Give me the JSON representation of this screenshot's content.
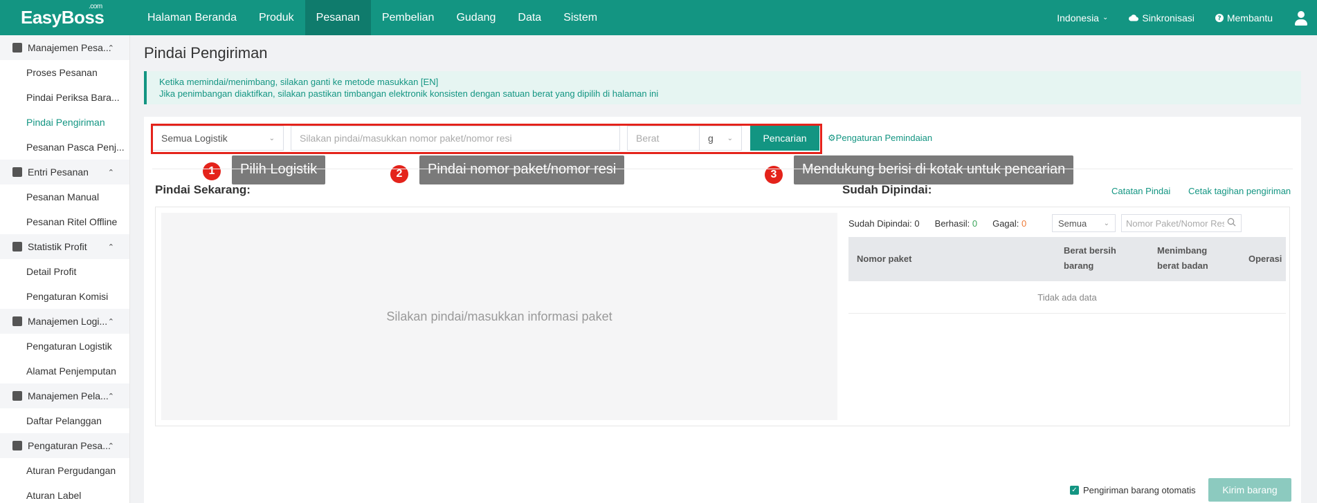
{
  "app": {
    "logo": "EasyBoss",
    "logo_sup": ".com"
  },
  "nav": {
    "items": [
      {
        "label": "Halaman Beranda"
      },
      {
        "label": "Produk"
      },
      {
        "label": "Pesanan"
      },
      {
        "label": "Pembelian"
      },
      {
        "label": "Gudang"
      },
      {
        "label": "Data"
      },
      {
        "label": "Sistem"
      }
    ],
    "active": "Pesanan",
    "language": "Indonesia",
    "sync": "Sinkronisasi",
    "help": "Membantu"
  },
  "sidebar": {
    "groups": [
      {
        "label": "Manajemen Pesa...",
        "items": [
          "Proses Pesanan",
          "Pindai Periksa Bara...",
          "Pindai Pengiriman",
          "Pesanan Pasca Penj..."
        ]
      },
      {
        "label": "Entri Pesanan",
        "items": [
          "Pesanan Manual",
          "Pesanan Ritel Offline"
        ]
      },
      {
        "label": "Statistik Profit",
        "items": [
          "Detail Profit",
          "Pengaturan Komisi"
        ]
      },
      {
        "label": "Manajemen Logi...",
        "items": [
          "Pengaturan Logistik",
          "Alamat Penjemputan"
        ]
      },
      {
        "label": "Manajemen Pela...",
        "items": [
          "Daftar Pelanggan"
        ]
      },
      {
        "label": "Pengaturan Pesa...",
        "items": [
          "Aturan Pergudangan",
          "Aturan Label"
        ]
      }
    ],
    "active_item": "Pindai Pengiriman"
  },
  "page": {
    "title": "Pindai Pengiriman",
    "notice_line1": "Ketika memindai/menimbang, silakan ganti ke metode masukkan [EN]",
    "notice_line2": "Jika penimbangan diaktifkan, silakan pastikan timbangan elektronik konsisten dengan satuan berat yang dipilih di halaman ini"
  },
  "search": {
    "logistics_value": "Semua Logistik",
    "package_placeholder": "Silakan pindai/masukkan nomor paket/nomor resi",
    "weight_placeholder": "Berat",
    "unit_value": "g",
    "button_label": "Pencarian",
    "settings_label": "Pengaturan Pemindaian"
  },
  "callouts": [
    {
      "num": "1",
      "text": "Pilih Logistik"
    },
    {
      "num": "2",
      "text": "Pindai nomor paket/nomor resi"
    },
    {
      "num": "3",
      "text": "Mendukung berisi di kotak untuk pencarian"
    }
  ],
  "scan_now": {
    "title": "Pindai Sekarang:",
    "placeholder": "Silakan pindai/masukkan informasi paket"
  },
  "scanned": {
    "title": "Sudah Dipindai:",
    "scan_log_link": "Catatan Pindai",
    "print_link": "Cetak tagihan pengiriman",
    "stat_scanned_label": "Sudah Dipindai:",
    "stat_scanned_value": "0",
    "stat_success_label": "Berhasil:",
    "stat_success_value": "0",
    "stat_fail_label": "Gagal:",
    "stat_fail_value": "0",
    "filter_value": "Semua",
    "filter_placeholder": "Nomor Paket/Nomor Resi",
    "columns": {
      "package": "Nomor paket",
      "net_weight_1": "Berat bersih",
      "net_weight_2": "barang",
      "weigh_1": "Menimbang",
      "weigh_2": "berat badan",
      "operation": "Operasi"
    },
    "no_data": "Tidak ada data"
  },
  "footer": {
    "auto_ship_label": "Pengiriman barang otomatis",
    "send_button": "Kirim barang"
  },
  "colors": {
    "brand": "#139582",
    "highlight": "#e4231b"
  }
}
